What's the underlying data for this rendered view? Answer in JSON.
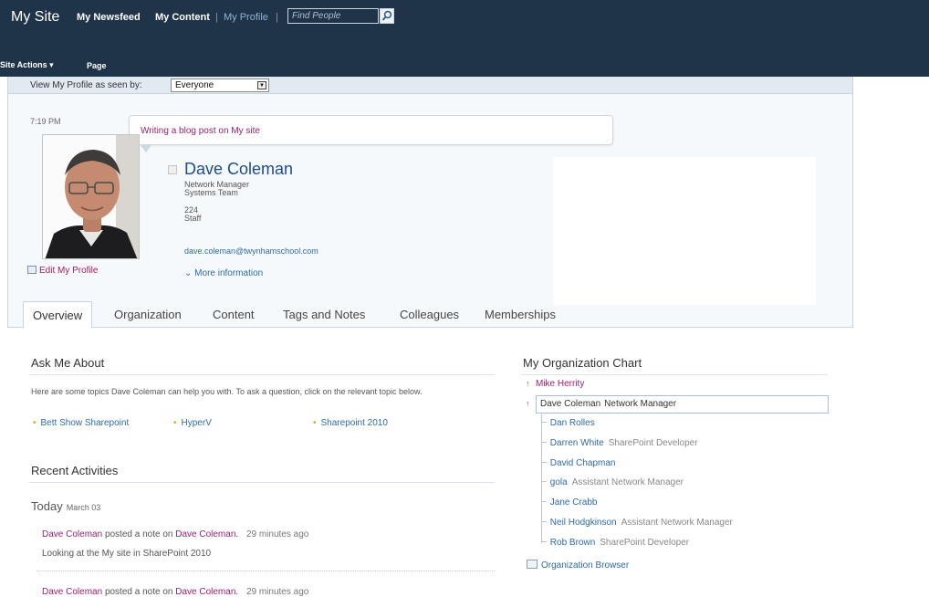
{
  "header": {
    "site_title": "My Site",
    "nav": {
      "newsfeed": "My Newsfeed",
      "content": "My Content",
      "separator": "|",
      "profile": "My Profile"
    },
    "search_placeholder": "Find People",
    "site_actions": "Site Actions ▾",
    "page_tab": "Page"
  },
  "seen_by": {
    "label": "View My Profile as seen by:",
    "value": "Everyone"
  },
  "profile": {
    "time": "7:19 PM",
    "status": "Writing a blog post on My site",
    "name": "Dave Coleman",
    "title": "Network Manager",
    "department": "Systems Team",
    "extension": "224",
    "office": "Staff",
    "email": "dave.coleman@twynhamschool.com",
    "more_info": "More information",
    "edit_link": "Edit My Profile"
  },
  "tabs": [
    "Overview",
    "Organization",
    "Content",
    "Tags and Notes",
    "Colleagues",
    "Memberships"
  ],
  "ask_me_about": {
    "heading": "Ask Me About",
    "description": "Here are some topics Dave Coleman can help you with. To ask a question, click on the relevant topic below.",
    "topics": [
      "Bett Show Sharepoint",
      "HyperV",
      "Sharepoint 2010"
    ]
  },
  "recent_activities": {
    "heading": "Recent Activities",
    "today": "Today",
    "date": "March 03",
    "items": [
      {
        "actor": "Dave Coleman",
        "verb": "posted a note on",
        "target": "Dave Coleman.",
        "ago": "29 minutes ago",
        "note": "Looking at the My site in SharePoint 2010"
      },
      {
        "actor": "Dave Coleman",
        "verb": "posted a note on",
        "target": "Dave Coleman.",
        "ago": "29 minutes ago"
      }
    ]
  },
  "org_chart": {
    "heading": "My Organization Chart",
    "manager": "Mike Herrity",
    "self_name": "Dave Coleman",
    "self_title": "Network Manager",
    "reports": [
      {
        "name": "Dan Rolles",
        "title": ""
      },
      {
        "name": "Darren White",
        "title": "SharePoint Developer"
      },
      {
        "name": "David Chapman",
        "title": ""
      },
      {
        "name": "gola",
        "title": "Assistant Network Manager"
      },
      {
        "name": "Jane Crabb",
        "title": ""
      },
      {
        "name": "Neil Hodgkinson",
        "title": "Assistant Network Manager"
      },
      {
        "name": "Rob Brown",
        "title": "SharePoint Developer"
      }
    ],
    "browser_link": "Organization Browser"
  }
}
